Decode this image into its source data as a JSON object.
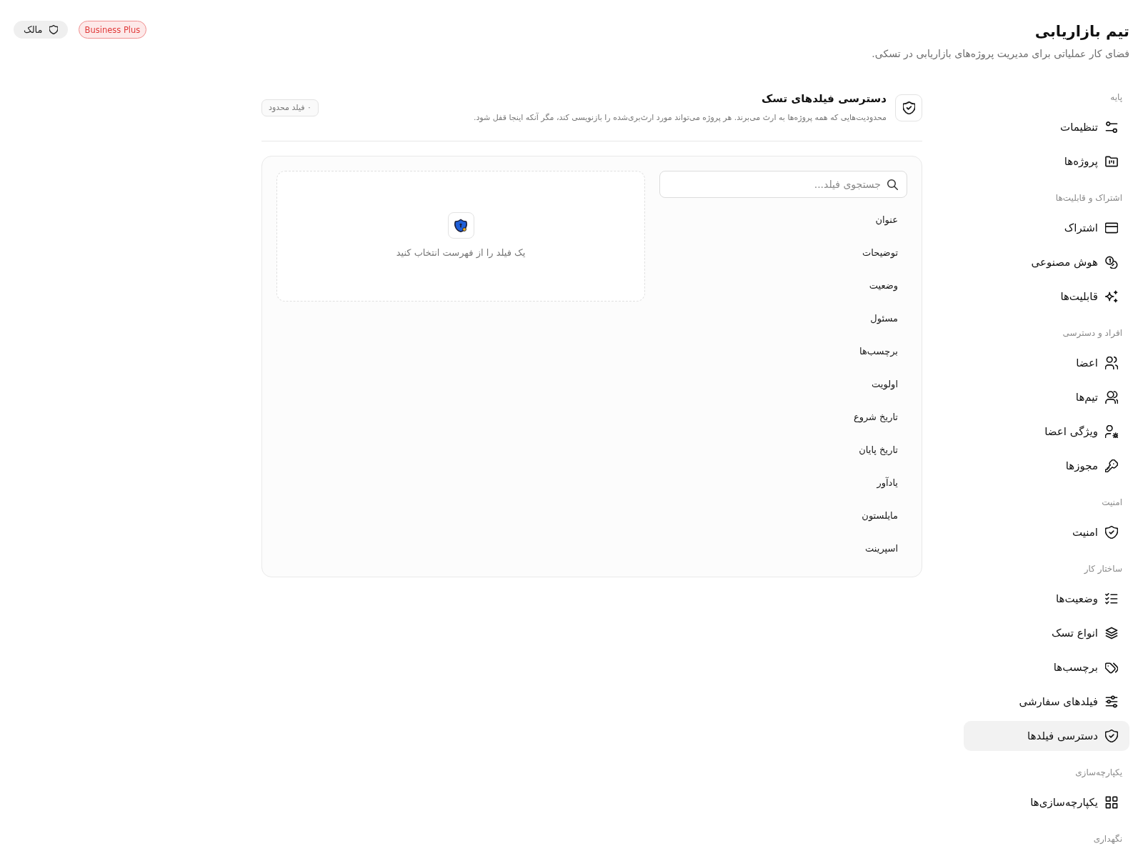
{
  "header": {
    "title": "تیم بازاریابی",
    "subtitle": "فضای کار عملیاتی برای مدیریت پروژه‌های بازاریابی در تسکی.",
    "badges": [
      {
        "kind": "plan",
        "label": "Business Plus"
      },
      {
        "kind": "role",
        "label": "مالک"
      }
    ]
  },
  "sidebar": {
    "sections": [
      {
        "title": "پایه",
        "items": [
          {
            "label": "تنظیمات",
            "selected": false
          },
          {
            "label": "پروژه‌ها",
            "selected": false
          }
        ]
      },
      {
        "title": "اشتراک و قابلیت‌ها",
        "items": [
          {
            "label": "اشتراک",
            "selected": false
          },
          {
            "label": "هوش مصنوعی",
            "selected": false
          },
          {
            "label": "قابلیت‌ها",
            "selected": false
          }
        ]
      },
      {
        "title": "افراد و دسترسی",
        "items": [
          {
            "label": "اعضا",
            "selected": false
          },
          {
            "label": "تیم‌ها",
            "selected": false
          },
          {
            "label": "ویژگی اعضا",
            "selected": false
          },
          {
            "label": "مجوزها",
            "selected": false
          }
        ]
      },
      {
        "title": "امنیت",
        "items": [
          {
            "label": "امنیت",
            "selected": false
          }
        ]
      },
      {
        "title": "ساختار کار",
        "items": [
          {
            "label": "وضعیت‌ها",
            "selected": false
          },
          {
            "label": "انواع تسک",
            "selected": false
          },
          {
            "label": "برچسب‌ها",
            "selected": false
          },
          {
            "label": "فیلدهای سفارشی",
            "selected": false
          },
          {
            "label": "دسترسی فیلدها",
            "selected": true
          }
        ]
      },
      {
        "title": "یکپارچه‌سازی",
        "items": [
          {
            "label": "یکپارچه‌سازی‌ها",
            "selected": false
          }
        ]
      },
      {
        "title": "نگهداری"
      }
    ]
  },
  "section": {
    "title": "دسترسی فیلدهای تسک",
    "description": "محدودیت‌هایی که همه پروژه‌ها به ارث می‌برند. هر پروژه می‌تواند مورد ارث‌بری‌شده را بازنویسی کند، مگر آنکه اینجا قفل شود.",
    "badge": "۰ فیلد محدود"
  },
  "field_picker": {
    "search": {
      "placeholder": "جستجوی فیلد..."
    },
    "fields": [
      {
        "label": "عنوان",
        "selected": false
      },
      {
        "label": "توضیحات",
        "selected": false
      },
      {
        "label": "وضعیت",
        "selected": false
      },
      {
        "label": "مسئول",
        "selected": false
      },
      {
        "label": "برچسب‌ها",
        "selected": false
      },
      {
        "label": "اولویت",
        "selected": false
      },
      {
        "label": "تاریخ شروع",
        "selected": false
      },
      {
        "label": "تاریخ پایان",
        "selected": false
      },
      {
        "label": "یادآور",
        "selected": false
      },
      {
        "label": "مایلستون",
        "selected": false
      },
      {
        "label": "اسپرینت",
        "selected": false
      }
    ],
    "empty_state": {
      "message": "یک فیلد را از فهرست انتخاب کنید"
    }
  }
}
